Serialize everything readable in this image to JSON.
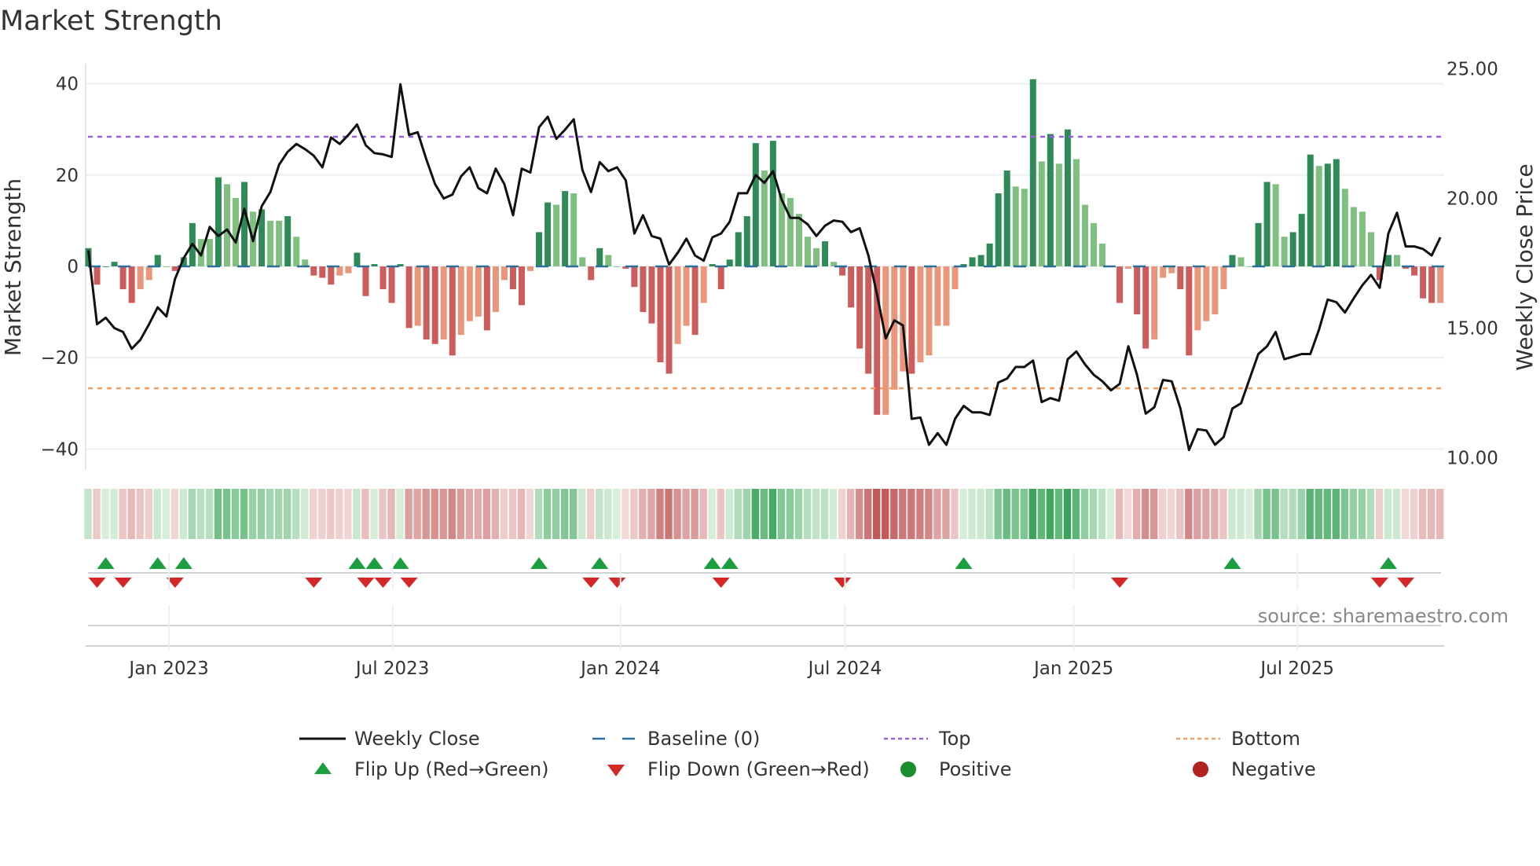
{
  "title": "Market Strength",
  "source": "source: sharemaestro.com",
  "colors": {
    "pos_rising": "#2e8b57",
    "pos_falling": "#7fbf7f",
    "neg_falling": "#cd5c5c",
    "neg_rising": "#e9967a",
    "baseline": "#2b6f9a",
    "top": "#9b5de5",
    "bottom": "#f0a060",
    "flip_up": "#1a9e3f",
    "flip_down": "#d62728",
    "positive": "#1a8f2e",
    "negative": "#b22222"
  },
  "chart_data": {
    "type": "bar",
    "title": "Market Strength",
    "ylabel": "Market Strength",
    "y2label": "Weekly Close Price",
    "ylim": [
      -45,
      44
    ],
    "y2lim": [
      9.0,
      26.0
    ],
    "yticks": [
      {
        "v": 40,
        "label": "40"
      },
      {
        "v": 20,
        "label": "20"
      },
      {
        "v": 0,
        "label": "0"
      },
      {
        "v": -20,
        "label": "−20"
      },
      {
        "v": -40,
        "label": "−40"
      }
    ],
    "y2ticks": [
      {
        "v": 25,
        "label": "25.00"
      },
      {
        "v": 20,
        "label": "20.00"
      },
      {
        "v": 15,
        "label": "15.00"
      },
      {
        "v": 10,
        "label": "10.00"
      }
    ],
    "xticks": [
      {
        "week": 9.3,
        "label": "Jan 2023"
      },
      {
        "week": 35.1,
        "label": "Jul 2023"
      },
      {
        "week": 61.4,
        "label": "Jan 2024"
      },
      {
        "week": 87.3,
        "label": "Jul 2024"
      },
      {
        "week": 113.7,
        "label": "Jan 2025"
      },
      {
        "week": 139.5,
        "label": "Jul 2025"
      }
    ],
    "top_level": 28.4,
    "bottom_level": -26.7,
    "baseline": 0,
    "strength": [
      4,
      -4,
      0,
      1,
      -5,
      -8,
      -5,
      -3,
      2.5,
      0,
      -1,
      2,
      9.5,
      6,
      6,
      19.5,
      18,
      15,
      18.5,
      12,
      12.5,
      10,
      10,
      11,
      6.5,
      1.5,
      -2,
      -2.5,
      -4,
      -2,
      -1.5,
      3,
      -6.5,
      0.5,
      -5,
      -8,
      0.5,
      -13.5,
      -13,
      -16,
      -17,
      -16,
      -19.5,
      -15,
      -12,
      -11,
      -14,
      -10,
      -3,
      -5,
      -8.5,
      -1,
      7.5,
      14,
      13.5,
      16.5,
      16,
      2,
      -3,
      4,
      2.5,
      0,
      -0.5,
      -4.5,
      -10,
      -12.5,
      -21,
      -23.5,
      -17,
      -13,
      -15,
      -8,
      0.5,
      -5,
      1.5,
      7.5,
      11,
      27,
      21,
      27.5,
      16,
      15,
      11.5,
      6.5,
      4,
      5.5,
      1,
      -2,
      -9,
      -18,
      -23.5,
      -32.5,
      -32.5,
      -27,
      -23,
      -23.5,
      -21,
      -19.5,
      -13,
      -13,
      -5,
      0.5,
      2,
      2.5,
      5,
      16,
      21,
      17.5,
      17,
      41,
      23,
      29,
      22.5,
      30,
      23.5,
      13.5,
      9.5,
      5,
      0,
      -8,
      -0.5,
      -10.5,
      -18,
      -16,
      -2.5,
      -1.5,
      -5,
      -19.5,
      -14,
      -12,
      -10.5,
      -5,
      2.5,
      2,
      0,
      9.5,
      18.5,
      18,
      6.5,
      7.5,
      11.5,
      24.5,
      22,
      22.5,
      23.5,
      17,
      13,
      12,
      7.5,
      -3,
      2.5,
      2.5,
      -0.5,
      -2,
      -7,
      -8,
      -8
    ],
    "weekly_close": [
      18.0,
      15.15,
      15.4,
      15.0,
      14.85,
      14.2,
      14.55,
      15.15,
      15.8,
      15.45,
      16.9,
      17.7,
      18.25,
      17.8,
      18.9,
      18.55,
      18.8,
      18.3,
      19.6,
      18.35,
      19.7,
      20.25,
      21.3,
      21.8,
      22.1,
      21.9,
      21.65,
      21.2,
      22.35,
      22.1,
      22.45,
      22.85,
      22.05,
      21.75,
      21.7,
      21.6,
      24.4,
      22.45,
      22.55,
      21.5,
      20.55,
      20.0,
      20.15,
      20.85,
      21.2,
      20.4,
      20.2,
      21.15,
      20.55,
      19.35,
      21.15,
      21.0,
      22.75,
      23.15,
      22.3,
      22.65,
      23.05,
      21.1,
      20.25,
      21.4,
      21.05,
      21.2,
      20.7,
      18.65,
      19.35,
      18.55,
      18.45,
      17.45,
      17.9,
      18.45,
      17.8,
      17.6,
      18.5,
      18.65,
      19.1,
      20.2,
      20.2,
      20.9,
      20.6,
      21.05,
      19.95,
      19.25,
      19.25,
      19.0,
      18.55,
      18.95,
      19.15,
      19.1,
      18.7,
      18.85,
      17.8,
      16.3,
      14.6,
      15.3,
      15.1,
      11.5,
      11.55,
      10.5,
      10.95,
      10.5,
      11.5,
      12.0,
      11.75,
      11.75,
      11.65,
      12.9,
      13.05,
      13.5,
      13.5,
      13.75,
      12.15,
      12.3,
      12.2,
      13.8,
      14.1,
      13.6,
      13.2,
      12.95,
      12.6,
      12.85,
      14.3,
      13.2,
      11.7,
      11.95,
      13.0,
      12.95,
      11.9,
      10.3,
      11.1,
      11.05,
      10.5,
      10.8,
      11.9,
      12.1,
      13.05,
      14.0,
      14.3,
      14.85,
      13.8,
      13.9,
      14.0,
      14.0,
      14.95,
      16.1,
      16.0,
      15.6,
      16.15,
      16.65,
      17.05,
      16.55,
      18.65,
      19.45,
      18.15,
      18.15,
      18.05,
      17.8,
      18.5
    ],
    "flip_up_weeks": [
      2,
      8,
      11,
      31,
      33,
      36,
      52,
      59,
      72,
      74,
      101,
      132,
      150
    ],
    "flip_down_weeks": [
      1,
      4,
      10,
      26,
      32,
      34,
      37,
      58,
      61,
      73,
      87,
      119,
      149,
      152
    ],
    "legend": {
      "placement": "bottom",
      "items": [
        {
          "key": "close",
          "label": "Weekly Close"
        },
        {
          "key": "baseline",
          "label": "Baseline (0)"
        },
        {
          "key": "top",
          "label": "Top"
        },
        {
          "key": "bottom",
          "label": "Bottom"
        },
        {
          "key": "flip_up",
          "label": "Flip Up (Red→Green)"
        },
        {
          "key": "flip_down",
          "label": "Flip Down (Green→Red)"
        },
        {
          "key": "positive",
          "label": "Positive"
        },
        {
          "key": "negative",
          "label": "Negative"
        }
      ]
    }
  }
}
